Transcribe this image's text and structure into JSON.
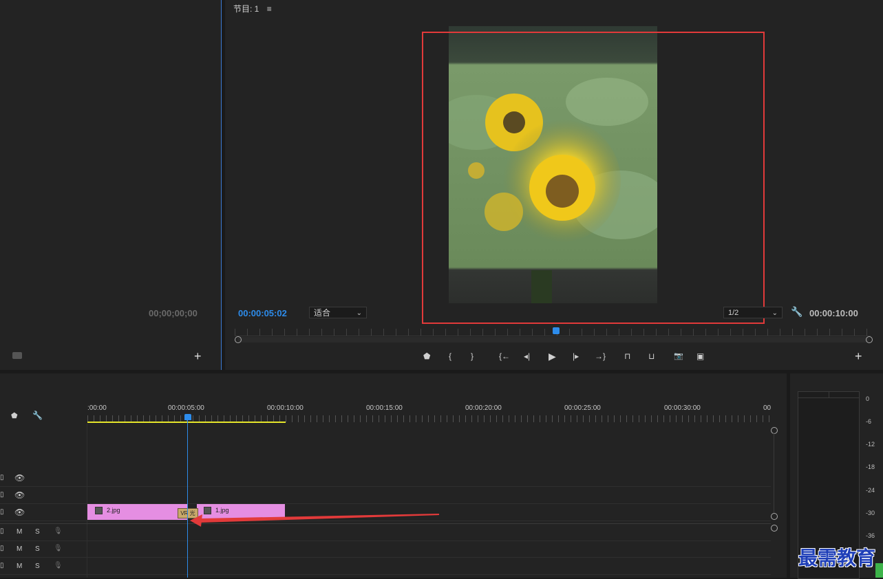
{
  "source_monitor": {
    "timecode": "00;00;00;00"
  },
  "program_monitor": {
    "title": "节目: 1",
    "menu_icon": "hamburger-menu-icon",
    "current_time": "00:00:05:02",
    "fit_select": "适合",
    "resolution_select": "1/2",
    "duration": "00:00:10:00"
  },
  "transport": {
    "icons": [
      "add-marker-icon",
      "mark-in-icon",
      "mark-out-icon",
      "go-to-in-icon",
      "step-back-icon",
      "play-icon",
      "step-forward-icon",
      "go-to-out-icon",
      "lift-icon",
      "extract-icon",
      "export-frame-icon",
      "comparison-view-icon"
    ],
    "glyphs": [
      "⬟",
      "{",
      "}",
      "{←",
      "◂|",
      "▶",
      "|▸",
      "→}",
      "⊓",
      "⊔",
      "📷",
      "▣"
    ]
  },
  "timeline": {
    "ruler_labels": [
      ":00:00",
      "00:00:05:00",
      "00:00:10:00",
      "00:00:15:00",
      "00:00:20:00",
      "00:00:25:00",
      "00:00:30:00",
      "00"
    ],
    "clips": [
      {
        "name": "2.jpg"
      },
      {
        "name": "1.jpg"
      }
    ],
    "transition_label": "VR 光",
    "audio_track_labels": {
      "mute": "M",
      "solo": "S"
    }
  },
  "audio_meter": {
    "scale": [
      "0",
      "-6",
      "-12",
      "-18",
      "-24",
      "-30",
      "-36"
    ]
  },
  "watermark": "最需教育",
  "colors": {
    "accent_blue": "#2d8ceb",
    "clip_pink": "#e58ee2",
    "highlight_red": "#e23a3a",
    "work_area_yellow": "#e6e62a"
  }
}
